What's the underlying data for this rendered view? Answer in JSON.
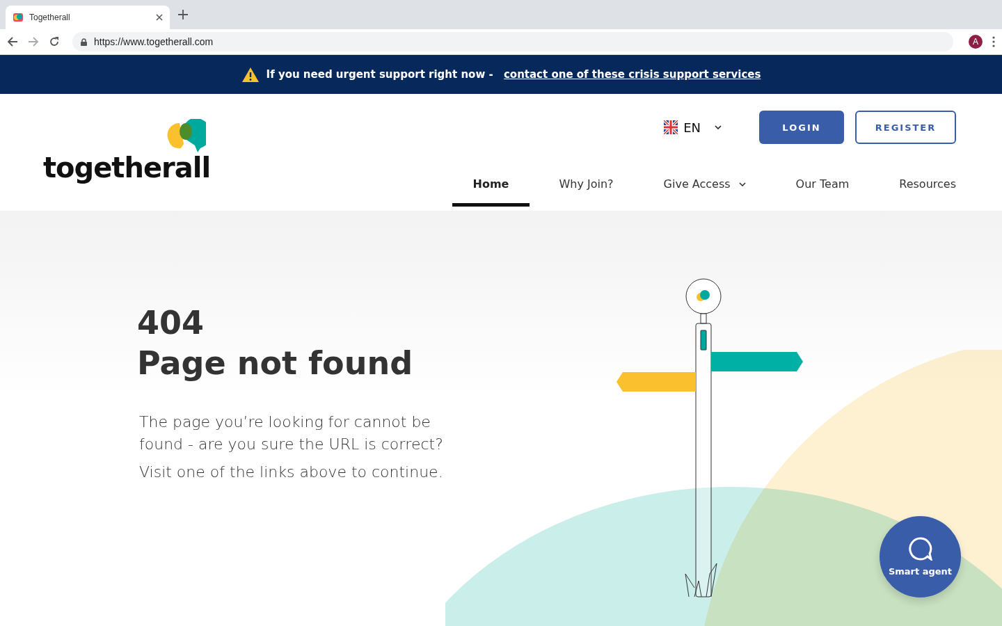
{
  "browser": {
    "tab": {
      "title": "Togetherall"
    },
    "address": "https://www.togetherall.com",
    "profile_initial": "A"
  },
  "banner": {
    "text": "If you need urgent support right now - ",
    "link": "contact one of these crisis support services"
  },
  "header": {
    "logo": "togetherall",
    "language": "EN",
    "buttons": [
      {
        "label": "LOGIN",
        "kind": "primary"
      },
      {
        "label": "REGISTER",
        "kind": "outline"
      }
    ],
    "nav": [
      {
        "label": "Home",
        "selected": true,
        "dropdown": false
      },
      {
        "label": "Why Join?",
        "selected": false,
        "dropdown": false
      },
      {
        "label": "Give Access",
        "selected": false,
        "dropdown": true
      },
      {
        "label": "Our Team",
        "selected": false,
        "dropdown": false
      },
      {
        "label": "Resources",
        "selected": false,
        "dropdown": false
      }
    ]
  },
  "error": {
    "code": "404",
    "title": "Page not found",
    "paragraphs": [
      "The page you’re looking for cannot be found - are you sure the URL is correct?",
      "Visit one of the links above to continue."
    ]
  },
  "chat_button": {
    "label": "Smart agent"
  }
}
